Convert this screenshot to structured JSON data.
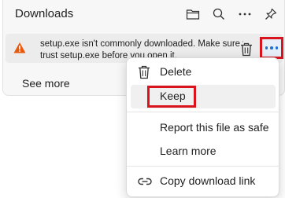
{
  "panel": {
    "title": "Downloads",
    "header_icons": [
      "folder-icon",
      "search-icon",
      "more-options-icon",
      "pin-icon"
    ],
    "see_more": "See more"
  },
  "download_item": {
    "line1": "setup.exe isn't commonly downloaded. Make sure you",
    "line2": "trust setup.exe before you open it.",
    "icons": [
      "warning-icon",
      "trash-icon",
      "more-actions-icon"
    ]
  },
  "menu": {
    "delete": "Delete",
    "keep": "Keep",
    "report": "Report this file as safe",
    "learn": "Learn more",
    "copy_link": "Copy download link"
  },
  "colors": {
    "highlight_border": "#d9141c",
    "warning": "#e8590c",
    "accent": "#1f6fd1"
  }
}
